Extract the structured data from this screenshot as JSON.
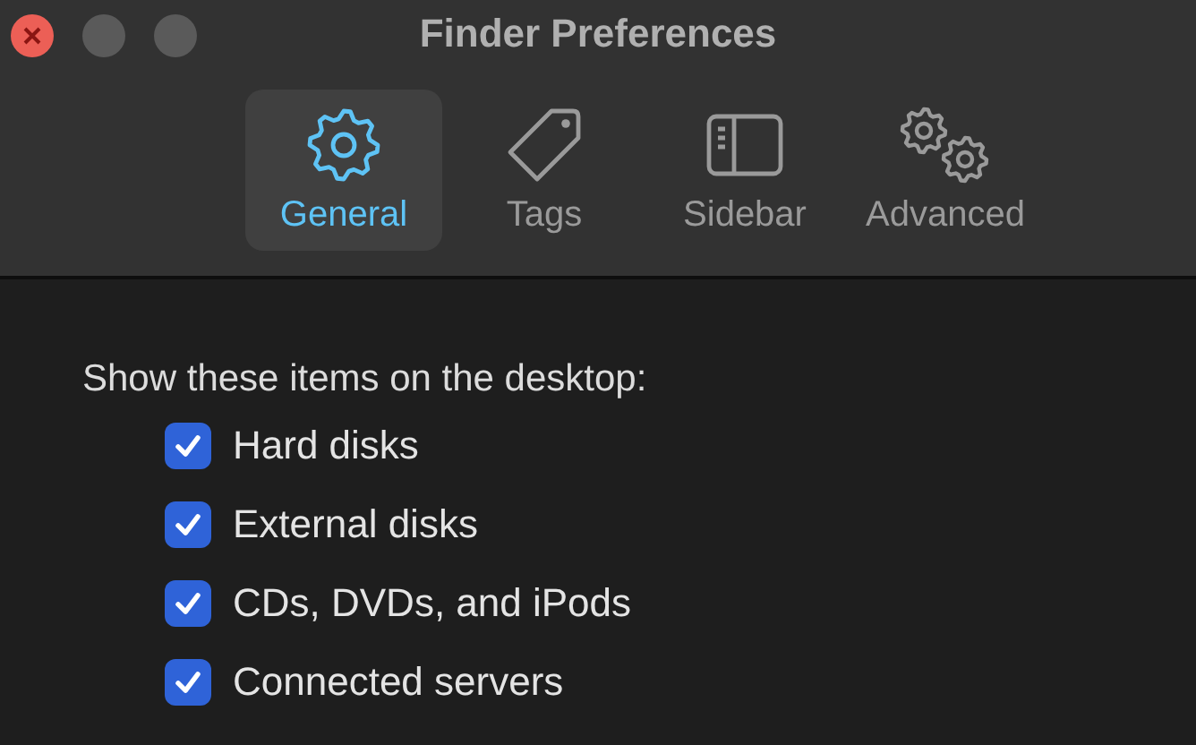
{
  "window": {
    "title": "Finder Preferences"
  },
  "tabs": [
    {
      "label": "General",
      "kind": "gear",
      "selected": true
    },
    {
      "label": "Tags",
      "kind": "tag",
      "selected": false
    },
    {
      "label": "Sidebar",
      "kind": "sidebar",
      "selected": false
    },
    {
      "label": "Advanced",
      "kind": "gears",
      "selected": false
    }
  ],
  "desktop_items": {
    "heading": "Show these items on the desktop:",
    "items": [
      {
        "label": "Hard disks",
        "checked": true
      },
      {
        "label": "External disks",
        "checked": true
      },
      {
        "label": "CDs, DVDs, and iPods",
        "checked": true
      },
      {
        "label": "Connected servers",
        "checked": true
      }
    ]
  }
}
